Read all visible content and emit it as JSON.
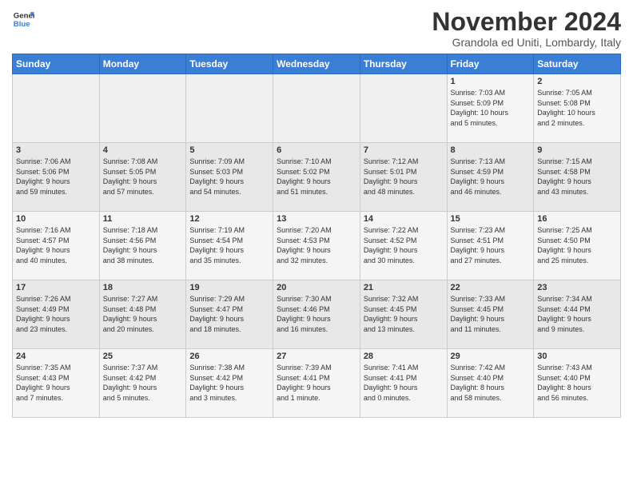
{
  "logo": {
    "line1": "General",
    "line2": "Blue"
  },
  "title": "November 2024",
  "subtitle": "Grandola ed Uniti, Lombardy, Italy",
  "headers": [
    "Sunday",
    "Monday",
    "Tuesday",
    "Wednesday",
    "Thursday",
    "Friday",
    "Saturday"
  ],
  "weeks": [
    [
      {
        "day": "",
        "info": ""
      },
      {
        "day": "",
        "info": ""
      },
      {
        "day": "",
        "info": ""
      },
      {
        "day": "",
        "info": ""
      },
      {
        "day": "",
        "info": ""
      },
      {
        "day": "1",
        "info": "Sunrise: 7:03 AM\nSunset: 5:09 PM\nDaylight: 10 hours\nand 5 minutes."
      },
      {
        "day": "2",
        "info": "Sunrise: 7:05 AM\nSunset: 5:08 PM\nDaylight: 10 hours\nand 2 minutes."
      }
    ],
    [
      {
        "day": "3",
        "info": "Sunrise: 7:06 AM\nSunset: 5:06 PM\nDaylight: 9 hours\nand 59 minutes."
      },
      {
        "day": "4",
        "info": "Sunrise: 7:08 AM\nSunset: 5:05 PM\nDaylight: 9 hours\nand 57 minutes."
      },
      {
        "day": "5",
        "info": "Sunrise: 7:09 AM\nSunset: 5:03 PM\nDaylight: 9 hours\nand 54 minutes."
      },
      {
        "day": "6",
        "info": "Sunrise: 7:10 AM\nSunset: 5:02 PM\nDaylight: 9 hours\nand 51 minutes."
      },
      {
        "day": "7",
        "info": "Sunrise: 7:12 AM\nSunset: 5:01 PM\nDaylight: 9 hours\nand 48 minutes."
      },
      {
        "day": "8",
        "info": "Sunrise: 7:13 AM\nSunset: 4:59 PM\nDaylight: 9 hours\nand 46 minutes."
      },
      {
        "day": "9",
        "info": "Sunrise: 7:15 AM\nSunset: 4:58 PM\nDaylight: 9 hours\nand 43 minutes."
      }
    ],
    [
      {
        "day": "10",
        "info": "Sunrise: 7:16 AM\nSunset: 4:57 PM\nDaylight: 9 hours\nand 40 minutes."
      },
      {
        "day": "11",
        "info": "Sunrise: 7:18 AM\nSunset: 4:56 PM\nDaylight: 9 hours\nand 38 minutes."
      },
      {
        "day": "12",
        "info": "Sunrise: 7:19 AM\nSunset: 4:54 PM\nDaylight: 9 hours\nand 35 minutes."
      },
      {
        "day": "13",
        "info": "Sunrise: 7:20 AM\nSunset: 4:53 PM\nDaylight: 9 hours\nand 32 minutes."
      },
      {
        "day": "14",
        "info": "Sunrise: 7:22 AM\nSunset: 4:52 PM\nDaylight: 9 hours\nand 30 minutes."
      },
      {
        "day": "15",
        "info": "Sunrise: 7:23 AM\nSunset: 4:51 PM\nDaylight: 9 hours\nand 27 minutes."
      },
      {
        "day": "16",
        "info": "Sunrise: 7:25 AM\nSunset: 4:50 PM\nDaylight: 9 hours\nand 25 minutes."
      }
    ],
    [
      {
        "day": "17",
        "info": "Sunrise: 7:26 AM\nSunset: 4:49 PM\nDaylight: 9 hours\nand 23 minutes."
      },
      {
        "day": "18",
        "info": "Sunrise: 7:27 AM\nSunset: 4:48 PM\nDaylight: 9 hours\nand 20 minutes."
      },
      {
        "day": "19",
        "info": "Sunrise: 7:29 AM\nSunset: 4:47 PM\nDaylight: 9 hours\nand 18 minutes."
      },
      {
        "day": "20",
        "info": "Sunrise: 7:30 AM\nSunset: 4:46 PM\nDaylight: 9 hours\nand 16 minutes."
      },
      {
        "day": "21",
        "info": "Sunrise: 7:32 AM\nSunset: 4:45 PM\nDaylight: 9 hours\nand 13 minutes."
      },
      {
        "day": "22",
        "info": "Sunrise: 7:33 AM\nSunset: 4:45 PM\nDaylight: 9 hours\nand 11 minutes."
      },
      {
        "day": "23",
        "info": "Sunrise: 7:34 AM\nSunset: 4:44 PM\nDaylight: 9 hours\nand 9 minutes."
      }
    ],
    [
      {
        "day": "24",
        "info": "Sunrise: 7:35 AM\nSunset: 4:43 PM\nDaylight: 9 hours\nand 7 minutes."
      },
      {
        "day": "25",
        "info": "Sunrise: 7:37 AM\nSunset: 4:42 PM\nDaylight: 9 hours\nand 5 minutes."
      },
      {
        "day": "26",
        "info": "Sunrise: 7:38 AM\nSunset: 4:42 PM\nDaylight: 9 hours\nand 3 minutes."
      },
      {
        "day": "27",
        "info": "Sunrise: 7:39 AM\nSunset: 4:41 PM\nDaylight: 9 hours\nand 1 minute."
      },
      {
        "day": "28",
        "info": "Sunrise: 7:41 AM\nSunset: 4:41 PM\nDaylight: 9 hours\nand 0 minutes."
      },
      {
        "day": "29",
        "info": "Sunrise: 7:42 AM\nSunset: 4:40 PM\nDaylight: 8 hours\nand 58 minutes."
      },
      {
        "day": "30",
        "info": "Sunrise: 7:43 AM\nSunset: 4:40 PM\nDaylight: 8 hours\nand 56 minutes."
      }
    ]
  ]
}
